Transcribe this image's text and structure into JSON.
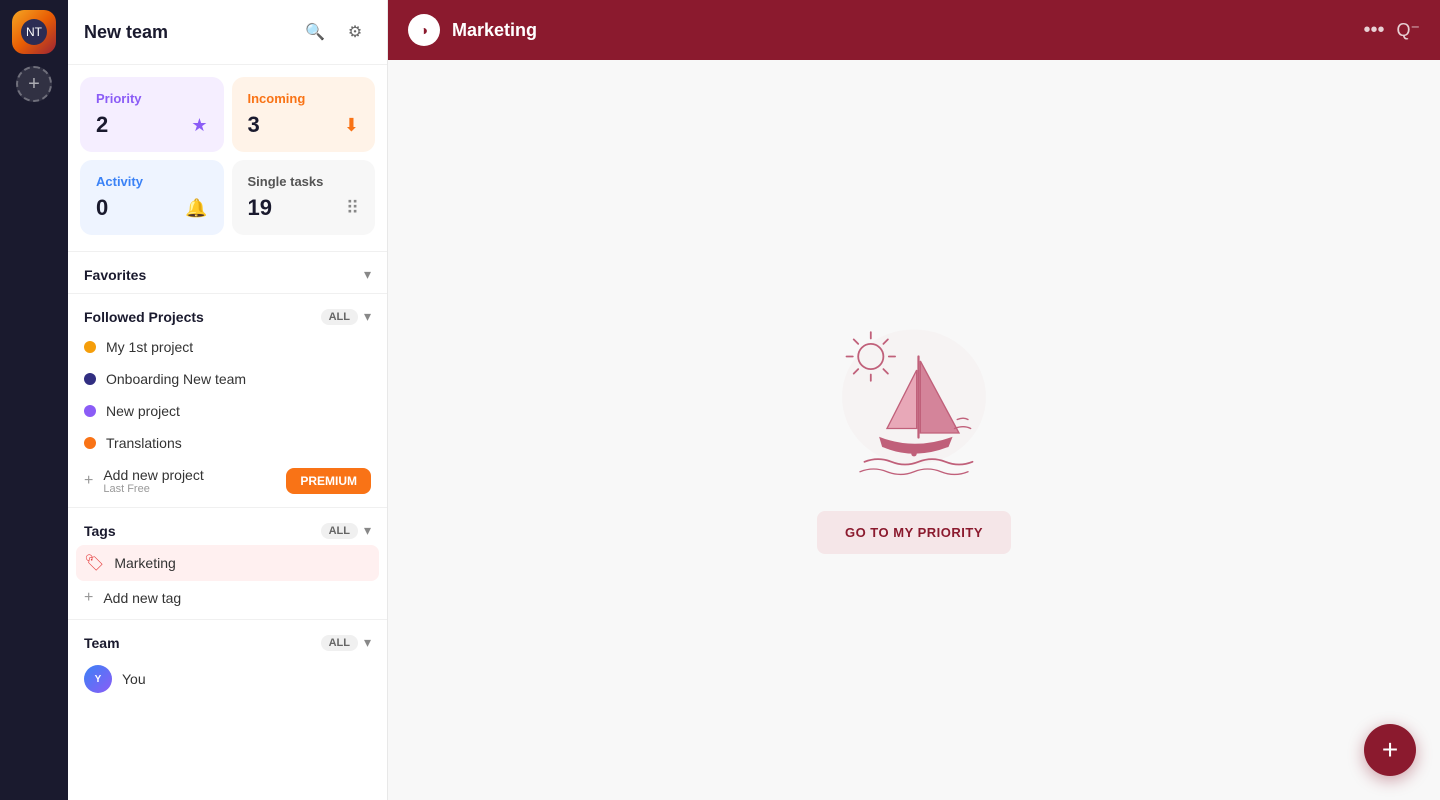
{
  "iconStrip": {
    "avatarLabel": "NT",
    "addWorkspaceLabel": "+"
  },
  "sidebar": {
    "title": "New team",
    "searchLabel": "🔍",
    "settingsLabel": "⚙",
    "statCards": [
      {
        "id": "priority",
        "type": "priority",
        "label": "Priority",
        "count": "2",
        "icon": "★"
      },
      {
        "id": "incoming",
        "type": "incoming",
        "label": "Incoming",
        "count": "3",
        "icon": "⬇"
      },
      {
        "id": "activity",
        "type": "activity",
        "label": "Activity",
        "count": "0",
        "icon": "🔔"
      },
      {
        "id": "single-tasks",
        "type": "single-tasks",
        "label": "Single tasks",
        "count": "19",
        "icon": "⠿"
      }
    ],
    "favorites": {
      "label": "Favorites",
      "chevron": "▾"
    },
    "followedProjects": {
      "label": "Followed Projects",
      "allBadge": "ALL",
      "chevron": "▾",
      "projects": [
        {
          "id": "p1",
          "name": "My 1st project",
          "color": "#f59e0b"
        },
        {
          "id": "p2",
          "name": "Onboarding New team",
          "color": "#312e81"
        },
        {
          "id": "p3",
          "name": "New project",
          "color": "#8b5cf6"
        },
        {
          "id": "p4",
          "name": "Translations",
          "color": "#f97316"
        }
      ],
      "addProjectLabel": "Add new project",
      "addProjectSub": "Last Free",
      "premiumBtn": "PREMIUM"
    },
    "tags": {
      "label": "Tags",
      "allBadge": "ALL",
      "chevron": "▾",
      "items": [
        {
          "id": "t1",
          "name": "Marketing",
          "color": "#e53e3e"
        }
      ],
      "addTagLabel": "Add new tag"
    },
    "team": {
      "label": "Team",
      "allBadge": "ALL",
      "chevron": "▾",
      "members": [
        {
          "id": "m1",
          "name": "You",
          "initials": "Y"
        }
      ]
    }
  },
  "mainHeader": {
    "logoText": "◑",
    "title": "Marketing",
    "dotsLabel": "•••",
    "rightIconLabel": "Q⁻"
  },
  "emptyState": {
    "buttonLabel": "GO TO MY PRIORITY"
  },
  "fab": {
    "label": "+"
  }
}
